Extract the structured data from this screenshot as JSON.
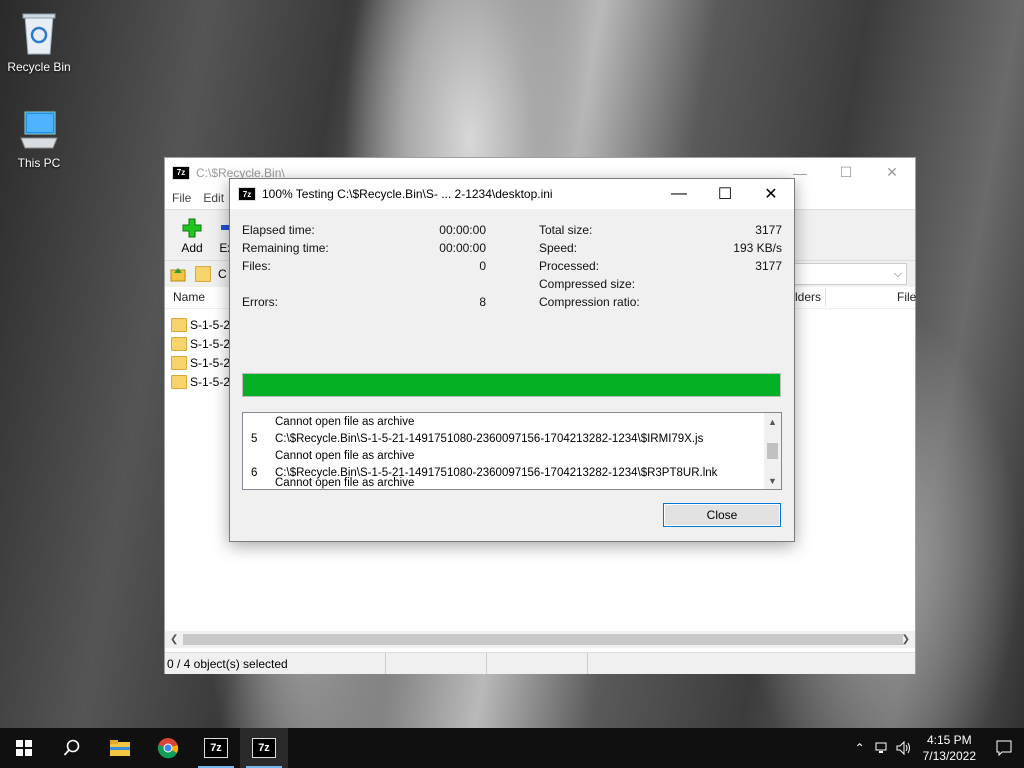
{
  "desktop": {
    "icons": [
      {
        "label": "Recycle Bin"
      },
      {
        "label": "This PC"
      }
    ]
  },
  "main_window": {
    "title": "C:\\$Recycle.Bin\\",
    "menu": [
      "File",
      "Edit"
    ],
    "toolbar": {
      "add": "Add",
      "extract": "Extr"
    },
    "address_first": "C",
    "columns": {
      "name": "Name",
      "folders": "lders",
      "files": "File"
    },
    "rows": [
      "S-1-5-21",
      "S-1-5-21",
      "S-1-5-21",
      "S-1-5-21"
    ],
    "status": "0 / 4 object(s) selected"
  },
  "dialog": {
    "title": "100% Testing C:\\$Recycle.Bin\\S- ... 2-1234\\desktop.ini",
    "left_stats": [
      {
        "label": "Elapsed time:",
        "value": "00:00:00"
      },
      {
        "label": "Remaining time:",
        "value": "00:00:00"
      },
      {
        "label": "Files:",
        "value": "0"
      },
      {
        "label": "Errors:",
        "value": "8"
      }
    ],
    "right_stats": [
      {
        "label": "Total size:",
        "value": "3177"
      },
      {
        "label": "Speed:",
        "value": "193 KB/s"
      },
      {
        "label": "Processed:",
        "value": "3177"
      },
      {
        "label": "Compressed size:",
        "value": ""
      },
      {
        "label": "Compression ratio:",
        "value": ""
      }
    ],
    "progress_percent": 100,
    "progress_color": "#06b025",
    "log": [
      {
        "num": "",
        "text": "Cannot open file as archive"
      },
      {
        "num": "5",
        "text": "C:\\$Recycle.Bin\\S-1-5-21-1491751080-2360097156-1704213282-1234\\$IRMI79X.js"
      },
      {
        "num": "",
        "text": "Cannot open file as archive"
      },
      {
        "num": "6",
        "text": "C:\\$Recycle.Bin\\S-1-5-21-1491751080-2360097156-1704213282-1234\\$R3PT8UR.lnk"
      },
      {
        "num": "",
        "text": "Cannot open file as archive"
      }
    ],
    "close_label": "Close"
  },
  "taskbar": {
    "time": "4:15 PM",
    "date": "7/13/2022",
    "apps": [
      "start-icon",
      "search-icon",
      "file-explorer-icon",
      "chrome-icon",
      "7zip-icon",
      "7zip-icon"
    ]
  }
}
